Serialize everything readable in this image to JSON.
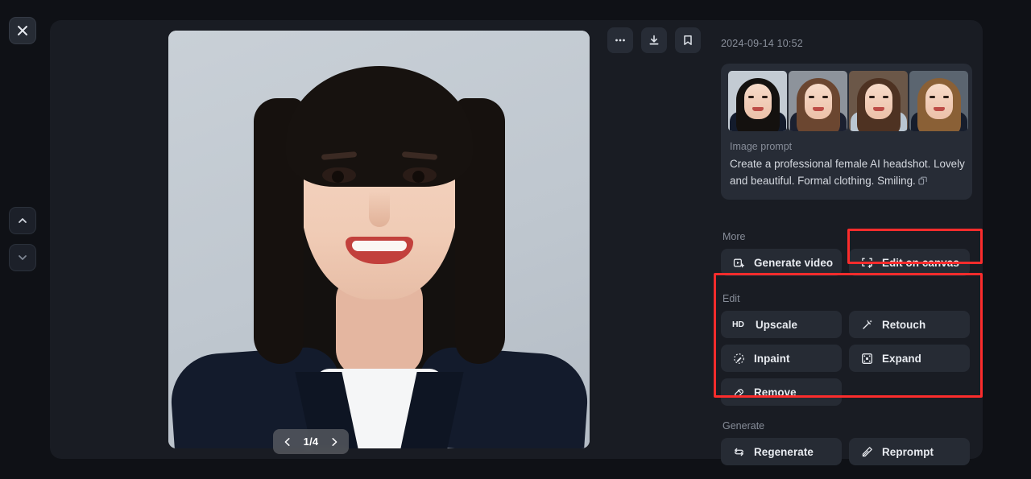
{
  "window": {
    "close_label": "Close",
    "nav_prev_label": "Previous",
    "nav_next_label": "Next"
  },
  "viewer": {
    "toolbar": [
      {
        "name": "more-options",
        "icon": "ellipsis-icon",
        "label": "More options"
      },
      {
        "name": "download",
        "icon": "download-icon",
        "label": "Download"
      },
      {
        "name": "bookmark",
        "icon": "bookmark-icon",
        "label": "Bookmark"
      }
    ],
    "pager": {
      "current": 1,
      "total": 4,
      "label": "1/4",
      "prev_label": "Previous image",
      "next_label": "Next image"
    }
  },
  "sidebar": {
    "timestamp": "2024-09-14 10:52",
    "prompt_card": {
      "prompt_label": "Image prompt",
      "prompt_text": "Create a professional female AI headshot. Lovely and beautiful. Formal clothing. Smiling.",
      "copy_label": "Copy prompt",
      "thumbnails": [
        {
          "alt": "Headshot 1",
          "bg": "#c3cbd3",
          "hair": "#14110f",
          "body": "#131b2c",
          "selected": true
        },
        {
          "alt": "Headshot 2",
          "bg": "#8d939b",
          "hair": "#6b4630",
          "body": "#1b2030",
          "selected": false
        },
        {
          "alt": "Headshot 3",
          "bg": "#6b5748",
          "hair": "#4e3222",
          "body": "#b9c6d2",
          "selected": false
        },
        {
          "alt": "Headshot 4",
          "bg": "#5b6570",
          "hair": "#8a6036",
          "body": "#161d2c",
          "selected": false
        }
      ]
    },
    "more": {
      "label": "More",
      "buttons": [
        {
          "name": "generate-video",
          "icon": "video-add-icon",
          "label": "Generate video"
        },
        {
          "name": "edit-on-canvas",
          "icon": "canvas-crop-icon",
          "label": "Edit on canvas"
        }
      ]
    },
    "edit": {
      "label": "Edit",
      "buttons": [
        {
          "name": "upscale",
          "icon": "hd-icon",
          "label": "Upscale"
        },
        {
          "name": "retouch",
          "icon": "magic-wand-icon",
          "label": "Retouch"
        },
        {
          "name": "inpaint",
          "icon": "inpaint-icon",
          "label": "Inpaint"
        },
        {
          "name": "expand",
          "icon": "expand-icon",
          "label": "Expand"
        },
        {
          "name": "remove",
          "icon": "eraser-icon",
          "label": "Remove"
        }
      ]
    },
    "generate": {
      "label": "Generate",
      "buttons": [
        {
          "name": "regenerate",
          "icon": "refresh-icon",
          "label": "Regenerate"
        },
        {
          "name": "reprompt",
          "icon": "pencil-icon",
          "label": "Reprompt"
        }
      ]
    }
  },
  "annotations": {
    "color": "#fb2c2c",
    "boxes": [
      {
        "name": "edit-on-canvas-highlight",
        "target": "Edit on canvas"
      },
      {
        "name": "edit-section-highlight",
        "target": "Edit"
      }
    ]
  }
}
